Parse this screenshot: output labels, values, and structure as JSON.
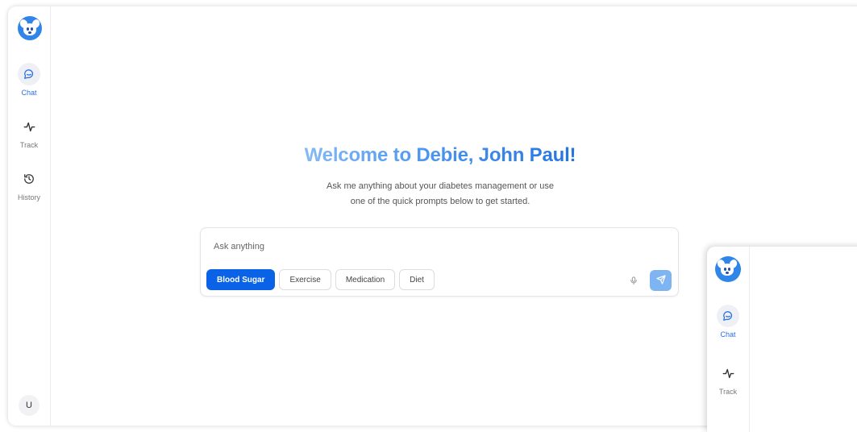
{
  "sidebar": {
    "items": [
      {
        "label": "Chat",
        "icon": "chat-bubble-icon",
        "active": true
      },
      {
        "label": "Track",
        "icon": "activity-pulse-icon",
        "active": false
      },
      {
        "label": "History",
        "icon": "history-clock-icon",
        "active": false
      }
    ],
    "user_initial": "U"
  },
  "main": {
    "title": "Welcome to Debie, John Paul!",
    "subtitle_line1": "Ask me anything about your diabetes management or use",
    "subtitle_line2": "one of the quick prompts below to get started."
  },
  "composer": {
    "placeholder": "Ask anything",
    "chips": [
      {
        "label": "Blood Sugar",
        "active": true
      },
      {
        "label": "Exercise",
        "active": false
      },
      {
        "label": "Medication",
        "active": false
      },
      {
        "label": "Diet",
        "active": false
      }
    ],
    "mic_icon": "microphone-icon",
    "send_icon": "send-paper-plane-icon"
  },
  "overlay_window": {
    "items": [
      {
        "label": "Chat",
        "icon": "chat-bubble-icon",
        "active": true
      },
      {
        "label": "Track",
        "icon": "activity-pulse-icon",
        "active": false
      }
    ]
  },
  "colors": {
    "accent": "#0a63e6",
    "accent_light": "#7fb4f3",
    "title_gradient_start": "#8ec0f5",
    "title_gradient_end": "#1e6ee0"
  }
}
